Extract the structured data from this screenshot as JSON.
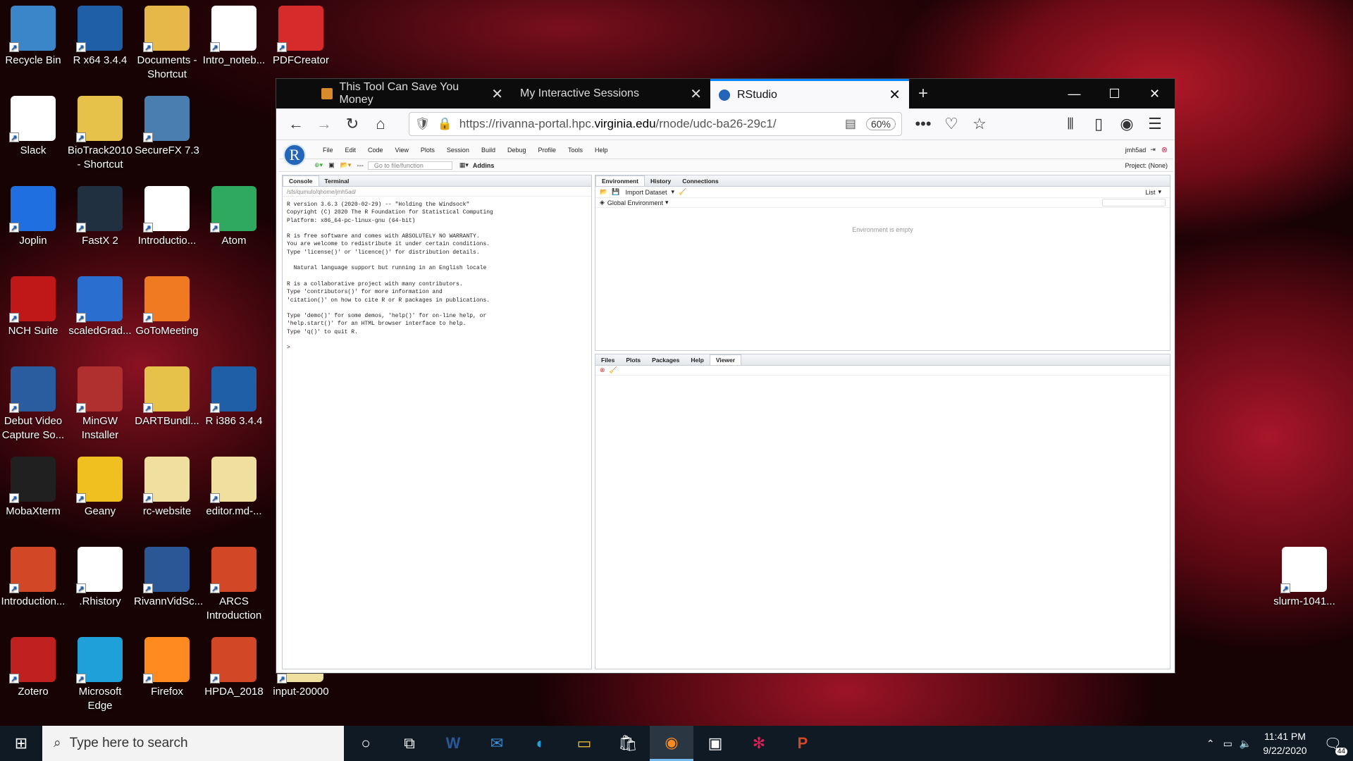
{
  "desktop": {
    "icons": [
      "Recycle Bin",
      "R x64 3.4.4",
      "Documents - Shortcut",
      "Intro_noteb...",
      "PDFCreator",
      "Slack",
      "BioTrack2010 - Shortcut",
      "SecureFX 7.3",
      "Joplin",
      "FastX 2",
      "Introductio...",
      "Atom",
      "NCH Suite",
      "scaledGrad...",
      "GoToMeeting",
      "Debut Video Capture So...",
      "MinGW Installer",
      "DARTBundl...",
      "R i386 3.4.4",
      "MobaXterm",
      "Geany",
      "rc-website",
      "editor.md-...",
      "Introduction...",
      ".Rhistory",
      "RivannVidSc...",
      "ARCS Introduction",
      "Zotero",
      "Microsoft Edge",
      "Firefox",
      "HPDA_2018",
      "input-20000",
      "slurm-1041..."
    ]
  },
  "browser": {
    "tabs": [
      {
        "label": "This Tool Can Save You Money"
      },
      {
        "label": "My Interactive Sessions"
      },
      {
        "label": "RStudio"
      }
    ],
    "url_prefix": "https://rivanna-portal.hpc.",
    "url_host": "virginia.edu",
    "url_suffix": "/rnode/udc-ba26-29c1/",
    "zoom": "60%"
  },
  "rstudio": {
    "menu": [
      "File",
      "Edit",
      "Code",
      "View",
      "Plots",
      "Session",
      "Build",
      "Debug",
      "Profile",
      "Tools",
      "Help"
    ],
    "user": "jmh5ad",
    "goto_placeholder": "Go to file/function",
    "addins": "Addins",
    "project": "Project: (None)",
    "console_tabs": [
      "Console",
      "Terminal"
    ],
    "console_path": "/sfs/qumulo/qhome/jmh5ad/",
    "console_text": "R version 3.6.3 (2020-02-29) -- \"Holding the Windsock\"\nCopyright (C) 2020 The R Foundation for Statistical Computing\nPlatform: x86_64-pc-linux-gnu (64-bit)\n\nR is free software and comes with ABSOLUTELY NO WARRANTY.\nYou are welcome to redistribute it under certain conditions.\nType 'license()' or 'licence()' for distribution details.\n\n  Natural language support but running in an English locale\n\nR is a collaborative project with many contributors.\nType 'contributors()' for more information and\n'citation()' on how to cite R or R packages in publications.\n\nType 'demo()' for some demos, 'help()' for on-line help, or\n'help.start()' for an HTML browser interface to help.\nType 'q()' to quit R.\n\n>",
    "env_tabs": [
      "Environment",
      "History",
      "Connections"
    ],
    "import_dataset": "Import Dataset",
    "list_label": "List",
    "global_env": "Global Environment",
    "env_empty": "Environment is empty",
    "files_tabs": [
      "Files",
      "Plots",
      "Packages",
      "Help",
      "Viewer"
    ]
  },
  "taskbar": {
    "search_placeholder": "Type here to search",
    "time": "11:41 PM",
    "date": "9/22/2020",
    "notifications": "44"
  }
}
